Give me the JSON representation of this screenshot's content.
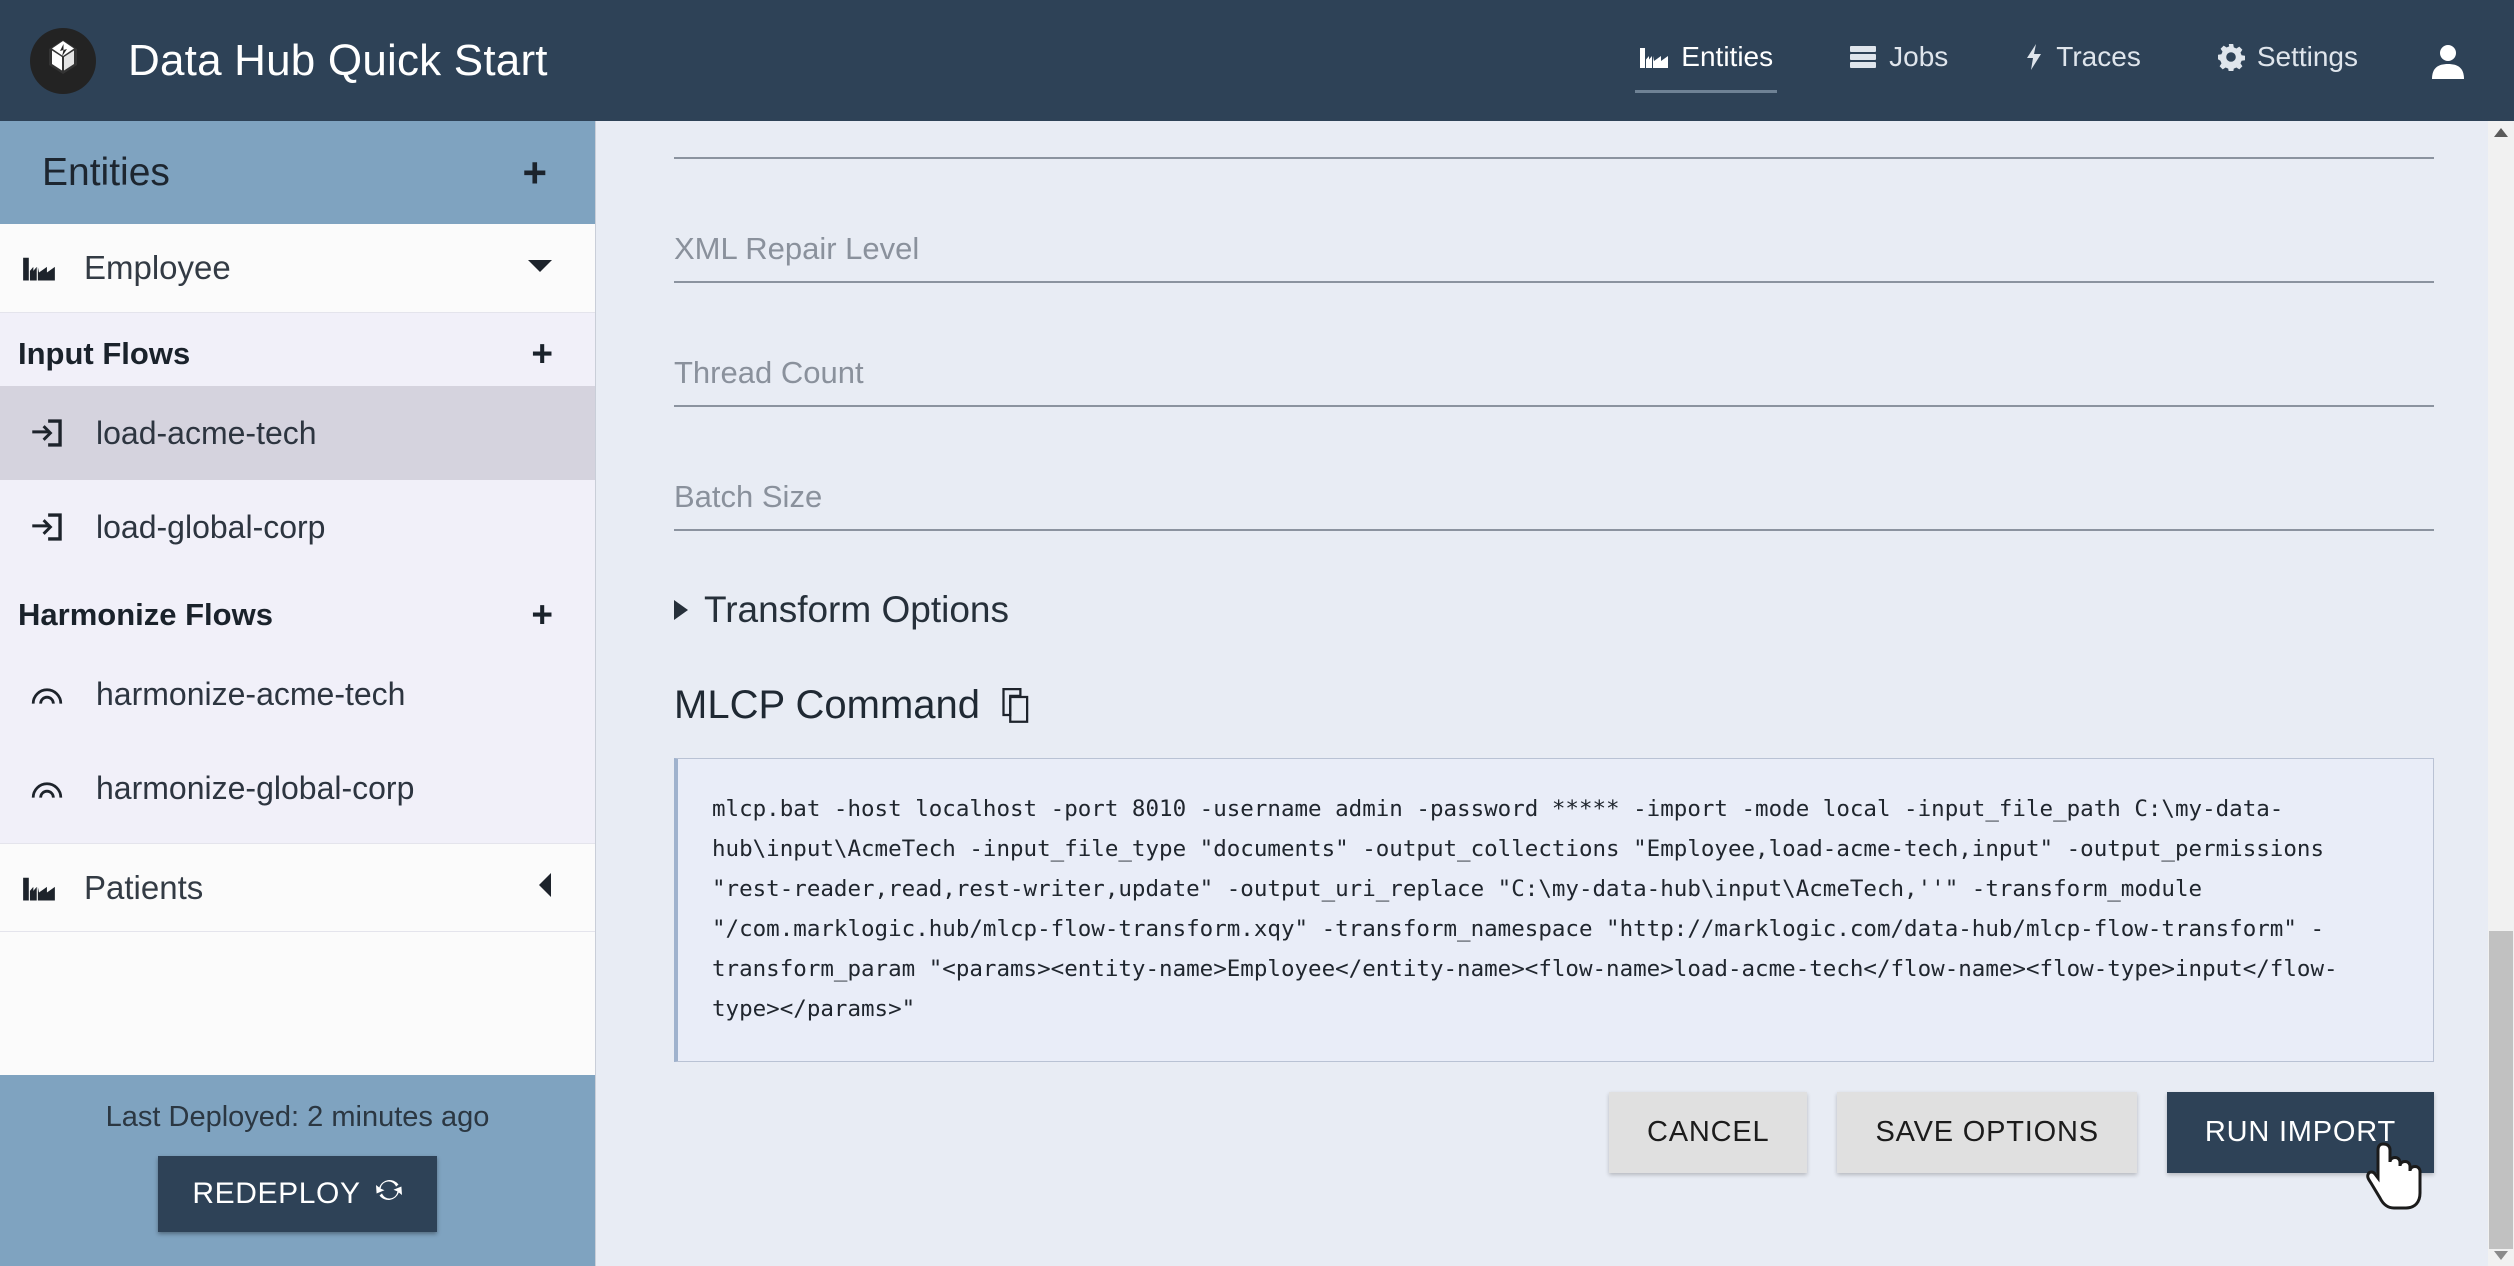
{
  "header": {
    "brand_title": "Data Hub Quick Start",
    "logo_icon": "marklogic-cube-icon",
    "nav": [
      {
        "label": "Entities",
        "icon": "factory-icon",
        "active": true
      },
      {
        "label": "Jobs",
        "icon": "server-stack-icon",
        "active": false
      },
      {
        "label": "Traces",
        "icon": "lightning-bolt-icon",
        "active": false
      },
      {
        "label": "Settings",
        "icon": "gear-icon",
        "active": false
      }
    ],
    "account_icon": "user-avatar-icon"
  },
  "sidebar": {
    "title": "Entities",
    "add_entity_label": "+",
    "entities": [
      {
        "name": "Employee",
        "icon": "factory-icon",
        "expanded": true,
        "toggle_icon": "chevron-down-icon",
        "groups": [
          {
            "title": "Input Flows",
            "add_label": "+",
            "flows": [
              {
                "name": "load-acme-tech",
                "icon": "input-arrow-icon",
                "selected": true
              },
              {
                "name": "load-global-corp",
                "icon": "input-arrow-icon",
                "selected": false
              }
            ]
          },
          {
            "title": "Harmonize Flows",
            "add_label": "+",
            "flows": [
              {
                "name": "harmonize-acme-tech",
                "icon": "arch-icon",
                "selected": false
              },
              {
                "name": "harmonize-global-corp",
                "icon": "arch-icon",
                "selected": false
              }
            ]
          }
        ]
      },
      {
        "name": "Patients",
        "icon": "factory-icon",
        "expanded": false,
        "toggle_icon": "chevron-left-icon",
        "groups": []
      }
    ],
    "footer": {
      "last_deployed": "Last Deployed: 2 minutes ago",
      "redeploy_label": "REDEPLOY",
      "redeploy_icon": "refresh-icon"
    }
  },
  "main": {
    "fields": [
      {
        "label": "",
        "value": "",
        "clipped": true
      },
      {
        "label": "XML Repair Level",
        "value": ""
      },
      {
        "label": "Thread Count",
        "value": ""
      },
      {
        "label": "Batch Size",
        "value": ""
      }
    ],
    "transform_options": {
      "label": "Transform Options",
      "expanded": false,
      "toggle_icon": "triangle-right-icon"
    },
    "mlcp": {
      "title": "MLCP Command",
      "copy_icon": "copy-icon",
      "command": "mlcp.bat -host localhost -port 8010 -username admin -password ***** -import -mode local -input_file_path C:\\my-data-hub\\input\\AcmeTech -input_file_type \"documents\" -output_collections \"Employee,load-acme-tech,input\" -output_permissions \"rest-reader,read,rest-writer,update\" -output_uri_replace \"C:\\my-data-hub\\input\\AcmeTech,''\" -transform_module \"/com.marklogic.hub/mlcp-flow-transform.xqy\" -transform_namespace \"http://marklogic.com/data-hub/mlcp-flow-transform\" -transform_param \"<params><entity-name>Employee</entity-name><flow-name>load-acme-tech</flow-name><flow-type>input</flow-type></params>\""
    },
    "actions": {
      "cancel_label": "CANCEL",
      "save_options_label": "SAVE OPTIONS",
      "run_import_label": "RUN IMPORT"
    }
  },
  "scrollbar": {
    "up_icon": "scroll-up-arrow-icon",
    "down_icon": "scroll-down-arrow-icon"
  },
  "colors": {
    "header_bg": "#2e4257",
    "sidebar_accent": "#7fa3c0",
    "sidebar_bg": "#f1f0f9",
    "content_bg": "#e8ecf4",
    "selected_flow": "#d5d3de",
    "primary_button": "#2e4257"
  }
}
